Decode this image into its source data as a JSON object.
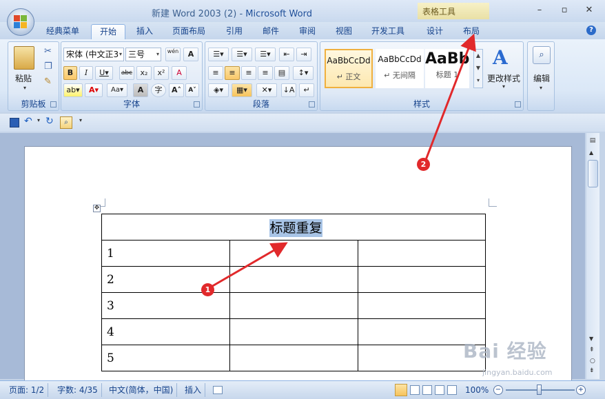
{
  "window": {
    "doc_title": "新建 Word 2003 (2) - ",
    "app": "Microsoft Word",
    "context_tab_group": "表格工具"
  },
  "tabs": [
    "经典菜单",
    "开始",
    "插入",
    "页面布局",
    "引用",
    "邮件",
    "审阅",
    "视图",
    "开发工具",
    "设计",
    "布局"
  ],
  "active_tab": "开始",
  "ribbon": {
    "clipboard": {
      "label": "剪贴板",
      "paste": "粘贴"
    },
    "font": {
      "label": "字体",
      "font_name": "宋体 (中文正3",
      "font_size": "三号",
      "phonetic": "wén"
    },
    "paragraph": {
      "label": "段落"
    },
    "styles": {
      "label": "样式",
      "items": [
        {
          "preview": "AaBbCcDd",
          "name": "↵ 正文"
        },
        {
          "preview": "AaBbCcDd",
          "name": "↵ 无间隔"
        },
        {
          "preview": "AaBb",
          "name": "标题 1"
        }
      ],
      "change_styles": "更改样式"
    },
    "editing": {
      "label": "编辑"
    }
  },
  "document": {
    "table_header": "标题重复",
    "rows": [
      "1",
      "2",
      "3",
      "4",
      "5"
    ]
  },
  "status": {
    "page": "页面: 1/2",
    "words": "字数: 4/35",
    "lang": "中文(简体，中国)",
    "mode": "插入",
    "zoom": "100%"
  },
  "watermark": {
    "brand": "Bai 经验",
    "url": "jingyan.baidu.com"
  },
  "annotations": [
    "1",
    "2"
  ],
  "colors": {
    "ribbon_bg": "#dbe8f7",
    "accent": "#15428b",
    "highlight": "#a8c4e6",
    "annotation": "#e1292b"
  }
}
